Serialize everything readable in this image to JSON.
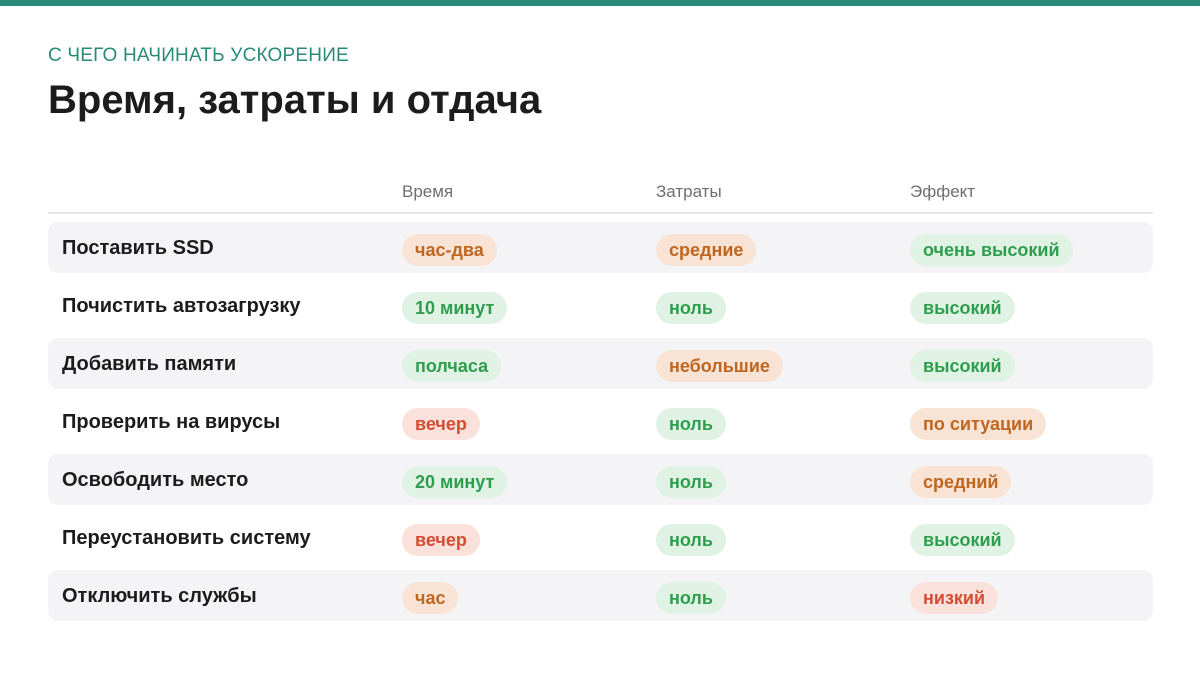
{
  "header": {
    "eyebrow": "С ЧЕГО НАЧИНАТЬ УСКОРЕНИЕ",
    "title": "Время, затраты и отдача"
  },
  "colors": {
    "accent": "#2a8a78",
    "orange": "#c0661f",
    "green": "#2e9e4e",
    "red": "#d44c33"
  },
  "table": {
    "columns": [
      "Время",
      "Затраты",
      "Эффект"
    ],
    "rows": [
      {
        "task": "Поставить SSD",
        "time": "час-два",
        "time_tone": "orange",
        "cost": "средние",
        "cost_tone": "orange",
        "effect": "очень высокий",
        "effect_tone": "green"
      },
      {
        "task": "Почистить автозагрузку",
        "time": "10 минут",
        "time_tone": "green",
        "cost": "ноль",
        "cost_tone": "green",
        "effect": "высокий",
        "effect_tone": "green"
      },
      {
        "task": "Добавить памяти",
        "time": "полчаса",
        "time_tone": "green",
        "cost": "небольшие",
        "cost_tone": "orange",
        "effect": "высокий",
        "effect_tone": "green"
      },
      {
        "task": "Проверить на вирусы",
        "time": "вечер",
        "time_tone": "red",
        "cost": "ноль",
        "cost_tone": "green",
        "effect": "по ситуации",
        "effect_tone": "orange"
      },
      {
        "task": "Освободить место",
        "time": "20 минут",
        "time_tone": "green",
        "cost": "ноль",
        "cost_tone": "green",
        "effect": "средний",
        "effect_tone": "orange"
      },
      {
        "task": "Переустановить систему",
        "time": "вечер",
        "time_tone": "red",
        "cost": "ноль",
        "cost_tone": "green",
        "effect": "высокий",
        "effect_tone": "green"
      },
      {
        "task": "Отключить службы",
        "time": "час",
        "time_tone": "orange",
        "cost": "ноль",
        "cost_tone": "green",
        "effect": "низкий",
        "effect_tone": "red"
      }
    ]
  }
}
